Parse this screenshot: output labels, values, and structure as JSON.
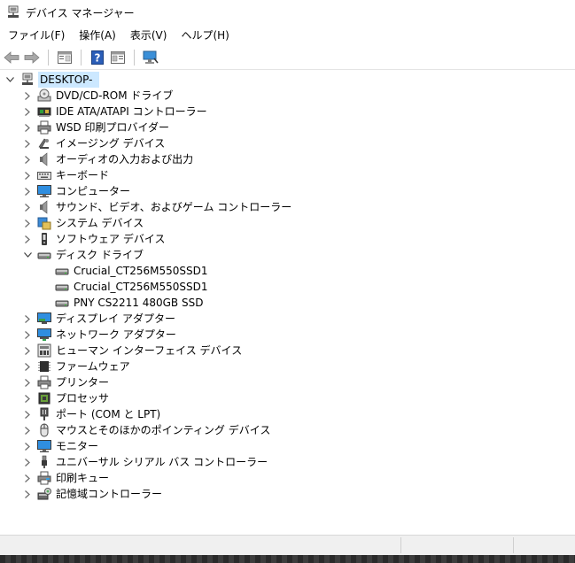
{
  "window": {
    "title": "デバイス マネージャー",
    "icon": "device-manager-icon"
  },
  "menu": {
    "file": "ファイル(F)",
    "action": "操作(A)",
    "view": "表示(V)",
    "help": "ヘルプ(H)"
  },
  "toolbar": {
    "buttons": [
      "back-arrow-icon",
      "forward-arrow-icon",
      "properties-icon",
      "help-icon",
      "update-view-icon",
      "scan-hardware-icon"
    ]
  },
  "tree": {
    "root": {
      "label": "DESKTOP-",
      "icon": "computer-network-icon",
      "expanded": true
    },
    "items": [
      {
        "label": "DVD/CD-ROM ドライブ",
        "icon": "dvd-drive-icon",
        "expanded": false
      },
      {
        "label": "IDE ATA/ATAPI コントローラー",
        "icon": "ide-controller-icon",
        "expanded": false
      },
      {
        "label": "WSD 印刷プロバイダー",
        "icon": "printer-icon",
        "expanded": false
      },
      {
        "label": "イメージング デバイス",
        "icon": "camera-icon",
        "expanded": false
      },
      {
        "label": "オーディオの入力および出力",
        "icon": "speaker-icon",
        "expanded": false
      },
      {
        "label": "キーボード",
        "icon": "keyboard-icon",
        "expanded": false
      },
      {
        "label": "コンピューター",
        "icon": "monitor-icon",
        "expanded": false
      },
      {
        "label": "サウンド、ビデオ、およびゲーム コントローラー",
        "icon": "speaker-icon",
        "expanded": false
      },
      {
        "label": "システム デバイス",
        "icon": "system-folder-icon",
        "expanded": false
      },
      {
        "label": "ソフトウェア デバイス",
        "icon": "software-device-icon",
        "expanded": false
      },
      {
        "label": "ディスク ドライブ",
        "icon": "disk-drive-icon",
        "expanded": true
      },
      {
        "label": "Crucial_CT256M550SSD1",
        "icon": "disk-drive-icon",
        "child": true
      },
      {
        "label": "Crucial_CT256M550SSD1",
        "icon": "disk-drive-icon",
        "child": true
      },
      {
        "label": "PNY CS2211 480GB SSD",
        "icon": "disk-drive-icon",
        "child": true
      },
      {
        "label": "ディスプレイ アダプター",
        "icon": "display-adapter-icon",
        "expanded": false
      },
      {
        "label": "ネットワーク アダプター",
        "icon": "network-adapter-icon",
        "expanded": false
      },
      {
        "label": "ヒューマン インターフェイス デバイス",
        "icon": "hid-icon",
        "expanded": false
      },
      {
        "label": "ファームウェア",
        "icon": "firmware-chip-icon",
        "expanded": false
      },
      {
        "label": "プリンター",
        "icon": "printer-icon",
        "expanded": false
      },
      {
        "label": "プロセッサ",
        "icon": "processor-icon",
        "expanded": false
      },
      {
        "label": "ポート (COM と LPT)",
        "icon": "port-icon",
        "expanded": false
      },
      {
        "label": "マウスとそのほかのポインティング デバイス",
        "icon": "mouse-icon",
        "expanded": false
      },
      {
        "label": "モニター",
        "icon": "monitor-icon",
        "expanded": false
      },
      {
        "label": "ユニバーサル シリアル バス コントローラー",
        "icon": "usb-icon",
        "expanded": false
      },
      {
        "label": "印刷キュー",
        "icon": "print-queue-icon",
        "expanded": false
      },
      {
        "label": "記憶域コントローラー",
        "icon": "storage-controller-icon",
        "expanded": false
      }
    ]
  },
  "colors": {
    "selection": "#cce8ff",
    "expander": "#6a6a6a",
    "status_bar": "#f0f0f0"
  }
}
